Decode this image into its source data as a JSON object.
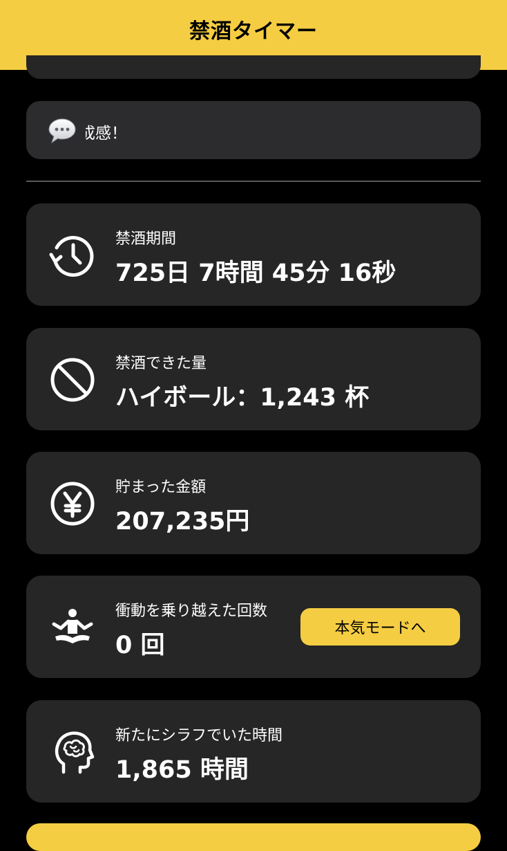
{
  "header": {
    "title": "禁酒タイマー"
  },
  "message": {
    "text": "成感！",
    "icon": "speech-bubble-icon"
  },
  "stats": [
    {
      "icon": "history-clock-icon",
      "label": "禁酒期間",
      "value": "725日 7時間 45分 16秒"
    },
    {
      "icon": "prohibited-icon",
      "label": "禁酒できた量",
      "value": "ハイボール：1,243 杯"
    },
    {
      "icon": "yen-icon",
      "label": "貯まった金額",
      "value": "207,235円"
    },
    {
      "icon": "meditation-icon",
      "label": "衝動を乗り越えた回数",
      "value": "0 回",
      "button_label": "本気モードへ"
    },
    {
      "icon": "brain-head-icon",
      "label": "新たにシラフでいた時間",
      "value": "1,865 時間"
    }
  ],
  "colors": {
    "accent": "#f5cd43",
    "background": "#000000",
    "card": "#262626",
    "message_card": "#2c2c2e",
    "text": "#ffffff"
  }
}
